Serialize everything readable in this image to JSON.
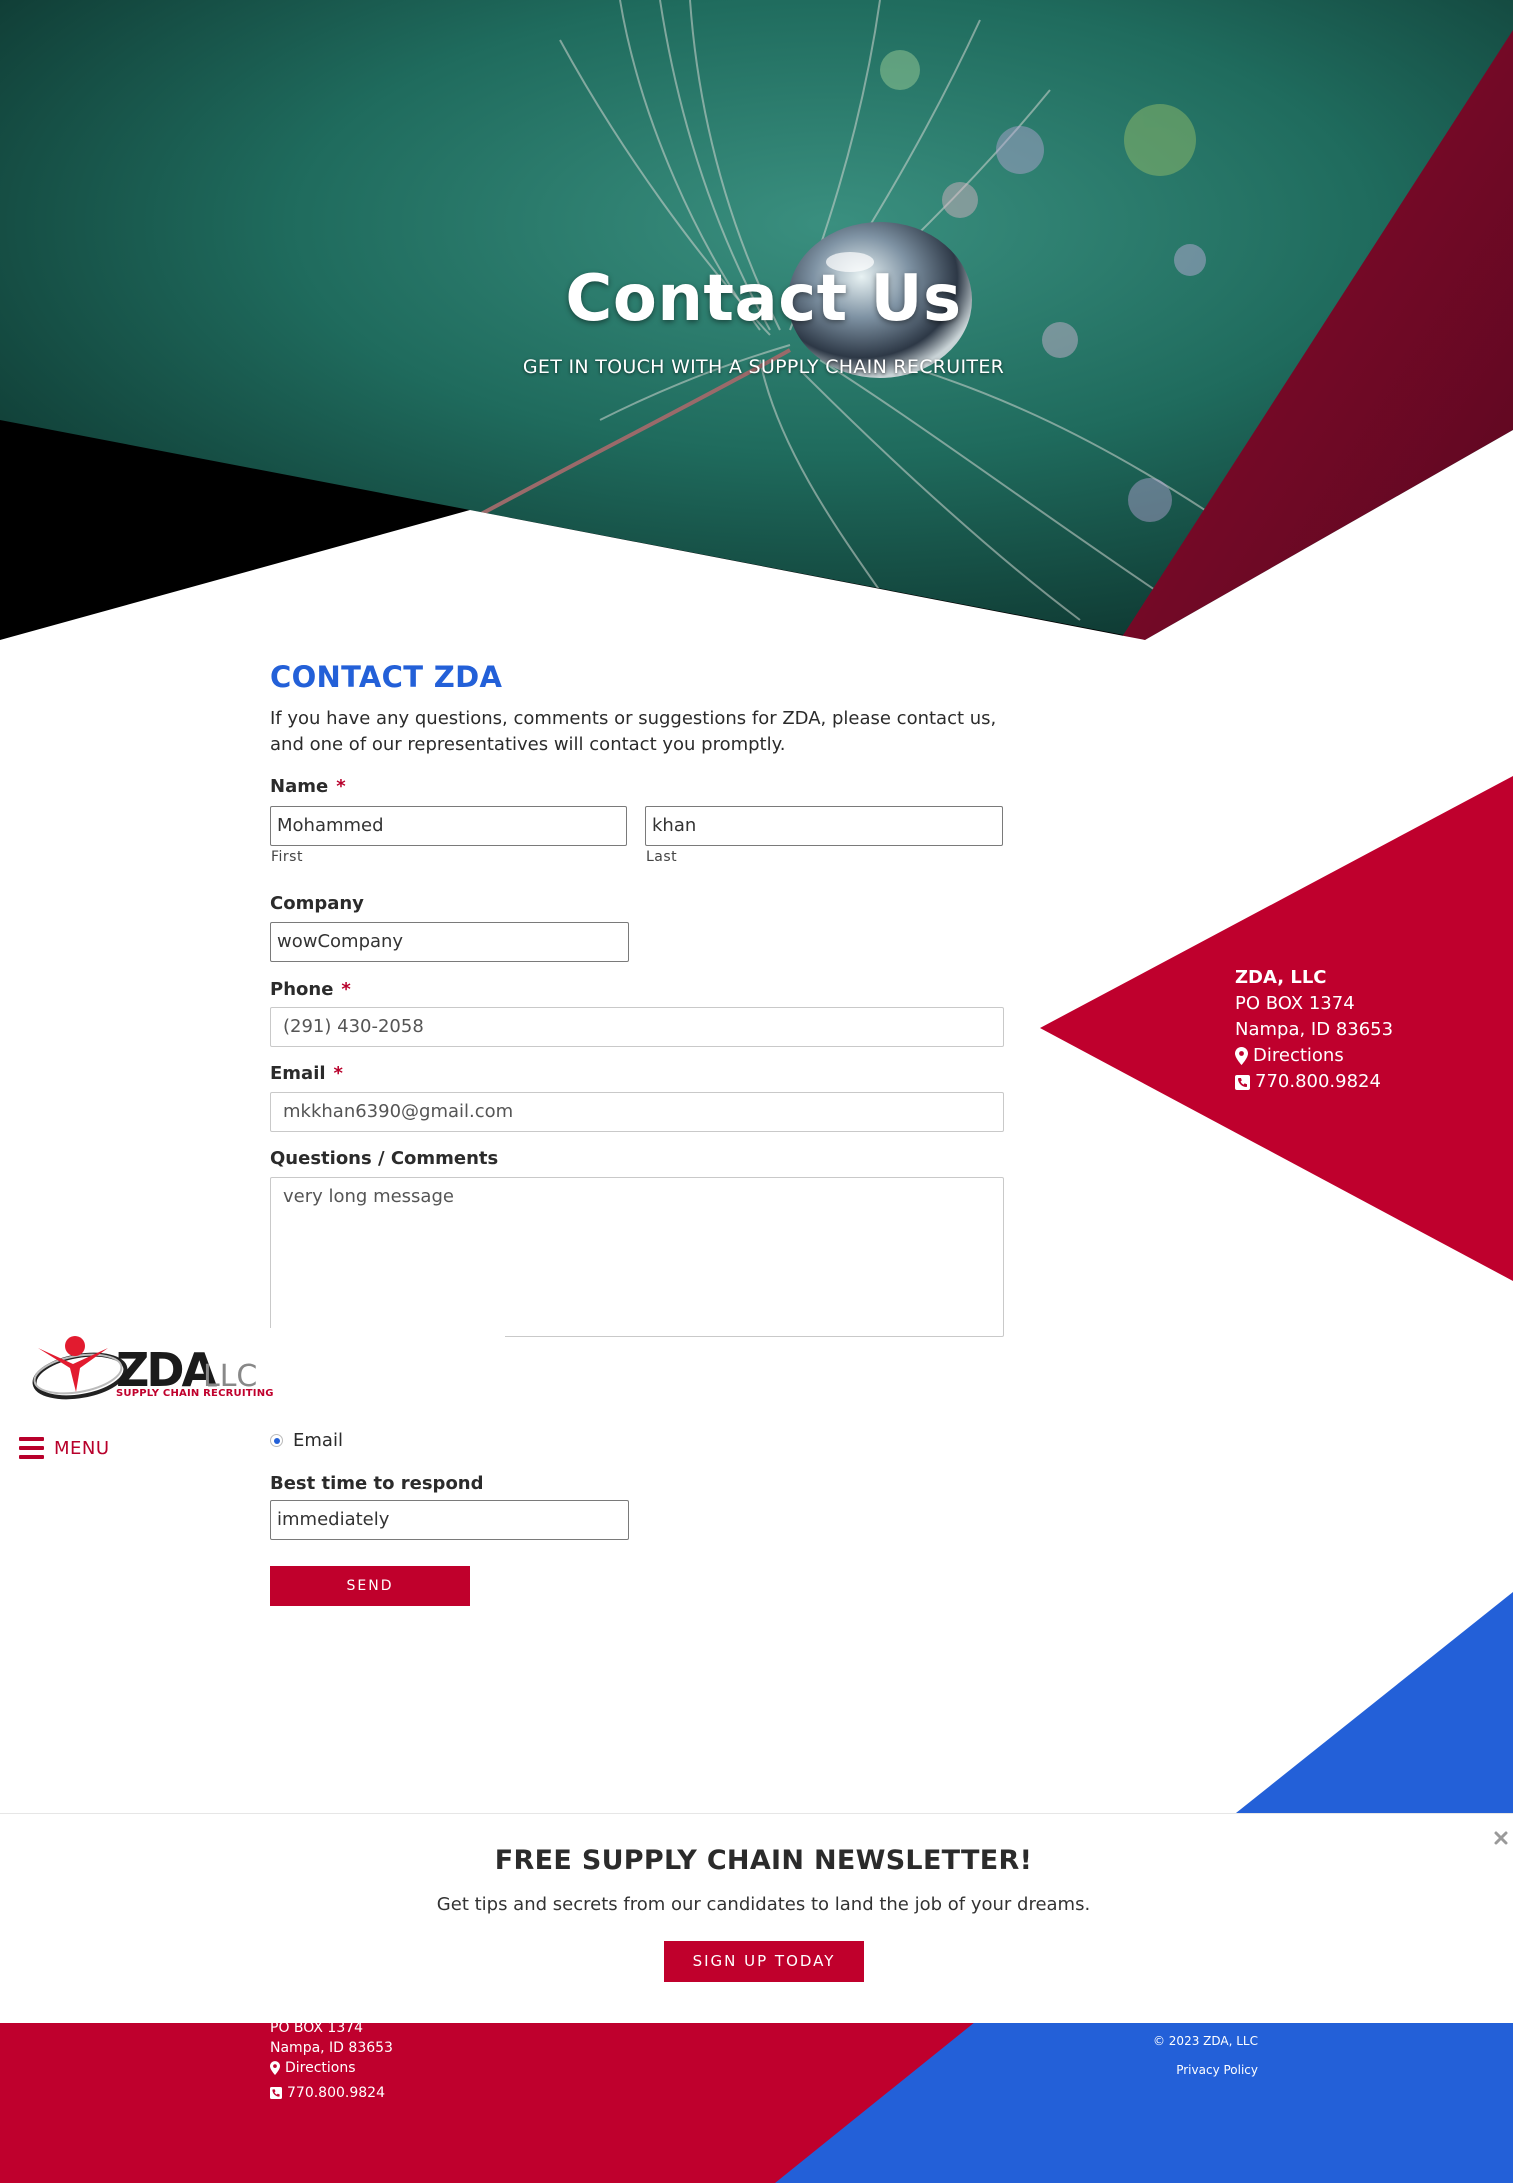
{
  "hero": {
    "title": "Contact Us",
    "subtitle": "GET IN TOUCH WITH A SUPPLY CHAIN RECRUITER"
  },
  "form": {
    "heading": "CONTACT ZDA",
    "intro": "If you have any questions, comments or suggestions for ZDA, please contact us, and one of our representatives will contact you promptly.",
    "name_label": "Name",
    "required_mark": "*",
    "first_value": "Mohammed",
    "first_sub": "First",
    "last_value": "khan",
    "last_sub": "Last",
    "company_label": "Company",
    "company_value": "wowCompany",
    "phone_label": "Phone",
    "phone_value": "(291) 430-2058",
    "email_label": "Email",
    "email_value": "mkkhan6390@gmail.com",
    "comments_label": "Questions / Comments",
    "comments_value": "very long message",
    "contact_method_option": "Email",
    "best_time_label": "Best time to respond",
    "best_time_value": "immediately",
    "send_label": "SEND"
  },
  "nav": {
    "logo_text": "ZDA",
    "logo_suffix": "LLC",
    "logo_tagline": "SUPPLY CHAIN RECRUITING",
    "menu_label": "MENU"
  },
  "address": {
    "company": "ZDA, LLC",
    "line1": "PO BOX 1374",
    "line2": "Nampa, ID 83653",
    "directions": "Directions",
    "phone": "770.800.9824"
  },
  "newsletter": {
    "title": "FREE SUPPLY CHAIN NEWSLETTER!",
    "text": "Get tips and secrets from our candidates to land the job of your dreams.",
    "button": "SIGN UP TODAY"
  },
  "footer": {
    "line1": "PO BOX 1374",
    "line2": "Nampa, ID 83653",
    "directions": "Directions",
    "phone": "770.800.9824",
    "copyright": "© 2023 ZDA, LLC",
    "privacy": "Privacy Policy"
  },
  "colors": {
    "brand_red": "#c0002c",
    "brand_blue": "#2360d8",
    "hero_teal": "#1e6a5c"
  },
  "icons": [
    "map-marker-icon",
    "phone-icon",
    "close-icon",
    "hamburger-icon"
  ]
}
